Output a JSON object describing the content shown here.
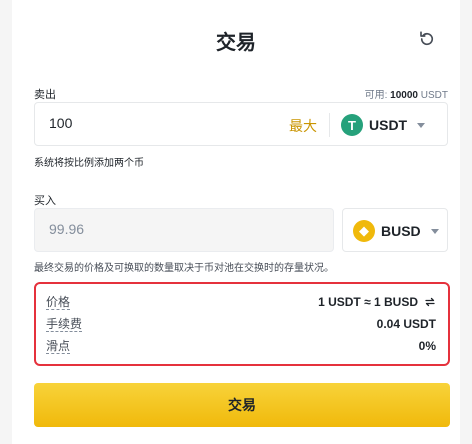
{
  "header": {
    "title": "交易"
  },
  "sell": {
    "label": "卖出",
    "available_prefix": "可用:",
    "available_amount": "10000",
    "available_unit": "USDT",
    "amount": "100",
    "max_label": "最大",
    "coin": "USDT",
    "coin_icon_glyph": "T",
    "hint": "系统将按比例添加两个币"
  },
  "buy": {
    "label": "买入",
    "amount": "99.96",
    "coin": "BUSD",
    "coin_icon_glyph": "◆",
    "hint": "最终交易的价格及可换取的数量取决于币对池在交换时的存量状况。"
  },
  "info": {
    "price_label": "价格",
    "price_value": "1 USDT ≈ 1 BUSD",
    "fee_label": "手续费",
    "fee_value": "0.04 USDT",
    "slippage_label": "滑点",
    "slippage_value": "0%"
  },
  "action": {
    "trade_label": "交易"
  },
  "colors": {
    "accent": "#f0b90b",
    "max_link": "#c99400",
    "highlight_border": "#e5313c",
    "usdt": "#26a17b"
  },
  "icons": {
    "refresh": "refresh-icon",
    "swap": "swap-arrows-icon",
    "caret": "caret-down-icon"
  }
}
